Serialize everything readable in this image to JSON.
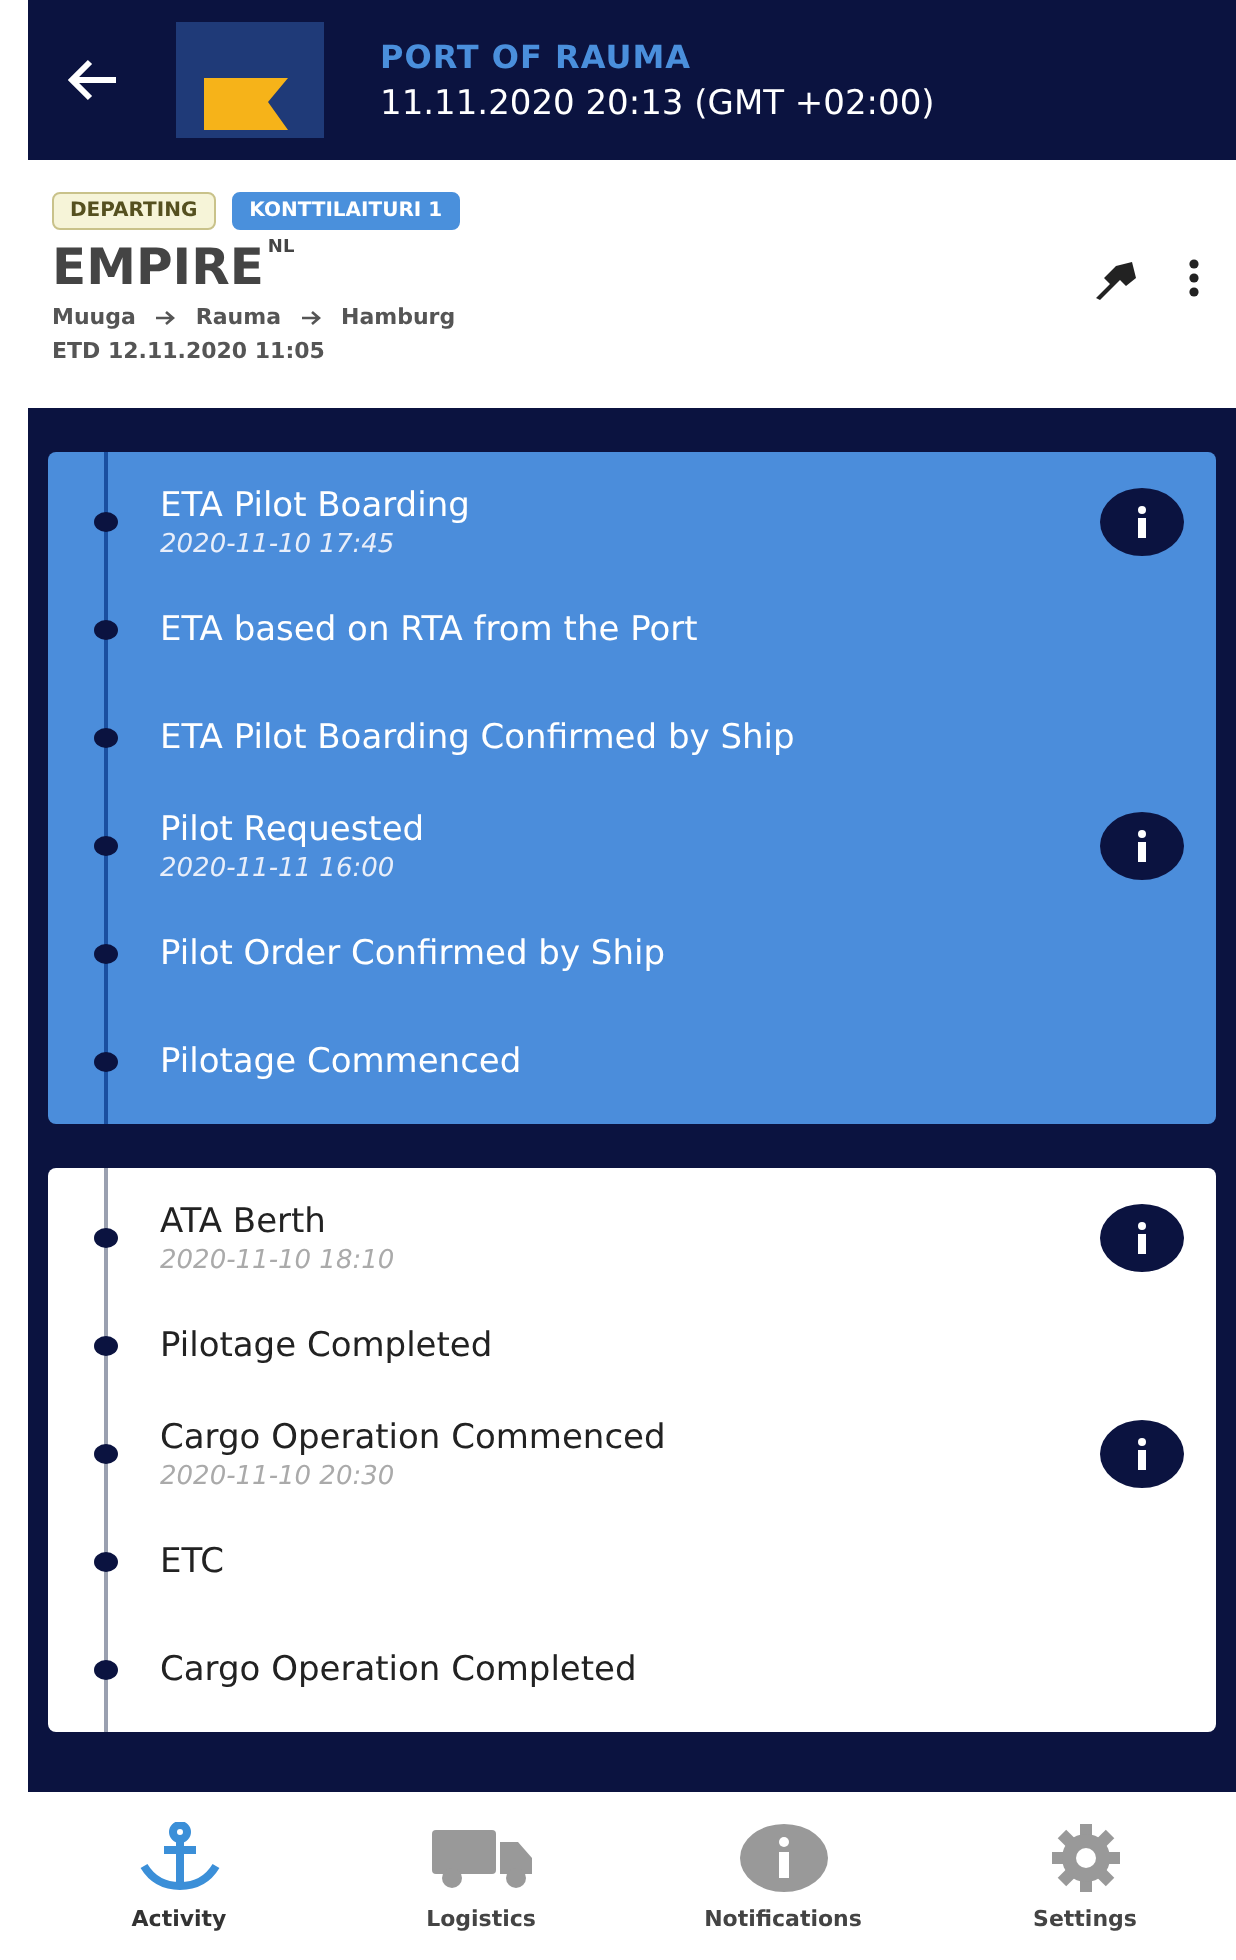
{
  "header": {
    "title": "PORT OF RAUMA",
    "datetime": "11.11.2020 20:13 (GMT +02:00)"
  },
  "vessel": {
    "badges": [
      {
        "label": "DEPARTING",
        "kind": "status"
      },
      {
        "label": "KONTTILAITURI 1",
        "kind": "berth"
      }
    ],
    "name": "EMPIRE",
    "flag": "NL",
    "route": [
      "Muuga",
      "Rauma",
      "Hamburg"
    ],
    "etd": "ETD 12.11.2020 11:05"
  },
  "sections": [
    {
      "highlighted": true,
      "events": [
        {
          "label": "ETA Pilot Boarding",
          "time": "2020-11-10 17:45",
          "info": true
        },
        {
          "label": "ETA based on RTA from the Port",
          "info": false
        },
        {
          "label": "ETA Pilot Boarding Confirmed by Ship",
          "info": false
        },
        {
          "label": "Pilot Requested",
          "time": "2020-11-11 16:00",
          "info": true
        },
        {
          "label": "Pilot Order Confirmed by Ship",
          "info": false
        },
        {
          "label": "Pilotage Commenced",
          "info": false
        }
      ]
    },
    {
      "highlighted": false,
      "events": [
        {
          "label": "ATA Berth",
          "time": "2020-11-10 18:10",
          "info": true
        },
        {
          "label": "Pilotage Completed",
          "info": false
        },
        {
          "label": "Cargo Operation Commenced",
          "time": "2020-11-10 20:30",
          "info": true
        },
        {
          "label": "ETC",
          "info": false
        },
        {
          "label": "Cargo Operation Completed",
          "info": false
        }
      ]
    }
  ],
  "nav": [
    {
      "label": "Activity",
      "kind": "anchor",
      "selected": true
    },
    {
      "label": "Logistics",
      "kind": "truck",
      "selected": false
    },
    {
      "label": "Notifications",
      "kind": "info",
      "selected": false
    },
    {
      "label": "Settings",
      "kind": "gear",
      "selected": false
    }
  ]
}
